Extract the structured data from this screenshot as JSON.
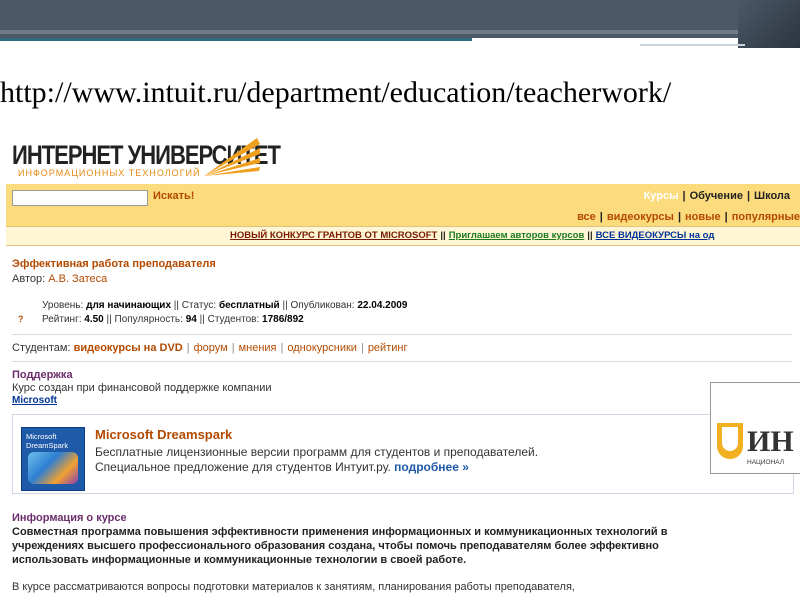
{
  "slide": {
    "url": "http://www.intuit.ru/department/education/teacherwork/"
  },
  "site": {
    "logo_title": "ИНТЕРНЕТ УНИВЕРСИТЕТ",
    "logo_subtitle": "ИНФОРМАЦИОННЫХ ТЕХНОЛОГИЙ",
    "search_button": "Искать!",
    "nav_primary": [
      "Курсы",
      "Обучение",
      "Школа"
    ],
    "nav_secondary": [
      "все",
      "видеокурсы",
      "новые",
      "популярные"
    ],
    "ads": {
      "ad1": "НОВЫЙ КОНКУРС ГРАНТОВ ОТ MICROSOFT",
      "ad2": "Приглашаем авторов курсов",
      "ad3": "ВСЕ ВИДЕОКУРСЫ на од",
      "sep": "||"
    }
  },
  "course": {
    "title": "Эффективная работа преподавателя",
    "author_label": "Автор:",
    "author_name": "А.В. Затеса",
    "level_label": "Уровень:",
    "level_value": "для начинающих",
    "status_label": "Статус:",
    "status_value": "бесплатный",
    "published_label": "Опубликован:",
    "published_value": "22.04.2009",
    "rating_label": "Рейтинг:",
    "rating_value": "4.50",
    "popularity_label": "Популярность:",
    "popularity_value": "94",
    "students_label": "Студентов:",
    "students_value": "1786/892",
    "question_mark": "?",
    "meta_sep": "||"
  },
  "students_links": {
    "label": "Студентам:",
    "items": [
      "видеокурсы на DVD",
      "форум",
      "мнения",
      "однокурсники",
      "рейтинг"
    ]
  },
  "support": {
    "heading": "Поддержка",
    "text": "Курс создан при финансовой поддержке компании",
    "link": "Microsoft"
  },
  "dreamspark": {
    "logo_text": "Microsoft DreamSpark",
    "title": "Microsoft Dreamspark",
    "line1": "Бесплатные лицензионные версии программ для студентов и преподавателей.",
    "line2": "Специальное предложение для студентов Интуит.ру.",
    "more": "подробнее »"
  },
  "info": {
    "heading": "Информация о курсе",
    "description": "Совместная программа повышения эффективности применения информационных и коммуникационных технологий в учреждениях высшего профессионального образования создана, чтобы помочь преподавателям более эффективно использовать информационные и коммуникационные технологии в своей работе.",
    "more_text": "В курсе рассматриваются вопросы подготовки материалов к занятиям, планирования работы преподавателя,"
  },
  "side_badge": {
    "letters": "ИН",
    "sub": "НАЦИОНАЛ"
  },
  "colors": {
    "accent": "#b34a00",
    "nav_bg": "#fbdb7c",
    "heading": "#6b2e6b",
    "link": "#003399"
  }
}
